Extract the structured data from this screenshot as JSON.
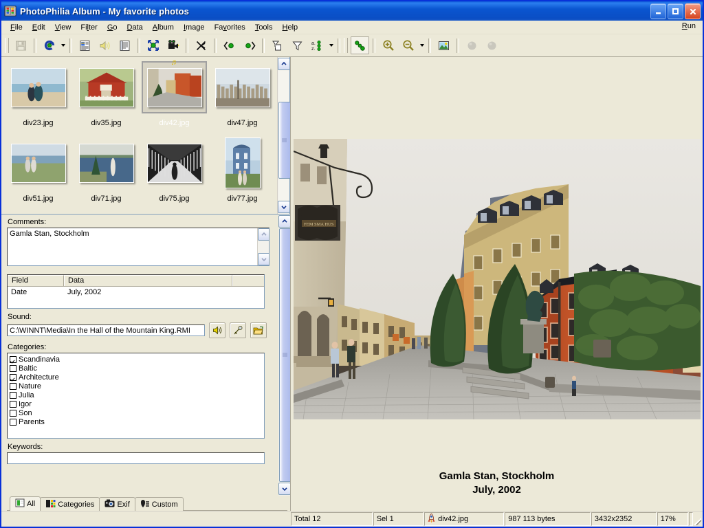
{
  "window": {
    "title": "PhotoPhilia Album - My favorite photos",
    "app_icon": "album-book-icon",
    "minimize_label": "Minimize",
    "maximize_label": "Maximize",
    "close_label": "Close"
  },
  "menu": {
    "items": [
      "File",
      "Edit",
      "View",
      "Filter",
      "Go",
      "Data",
      "Album",
      "Image",
      "Favorites",
      "Tools",
      "Help"
    ],
    "right_item": "Run"
  },
  "toolbar": {
    "buttons": [
      {
        "name": "save-button",
        "icon": "floppy-disk-icon",
        "state": "disabled"
      },
      {
        "name": "refresh-button",
        "icon": "blue-circular-arrow-icon",
        "state": "normal",
        "has_dropdown": true
      },
      {
        "name": "properties-button",
        "icon": "properties-sheet-icon",
        "state": "normal"
      },
      {
        "name": "sound-button",
        "icon": "speaker-icon",
        "state": "disabled"
      },
      {
        "name": "details-button",
        "icon": "list-details-icon",
        "state": "normal"
      },
      {
        "name": "fullscreen-button",
        "icon": "expand-arrows-icon",
        "state": "normal"
      },
      {
        "name": "slideshow-button",
        "icon": "movie-camera-icon",
        "state": "normal"
      },
      {
        "name": "random-button",
        "icon": "shuffle-icon",
        "state": "normal"
      },
      {
        "name": "previous-button",
        "icon": "left-arrow-icon",
        "state": "normal"
      },
      {
        "name": "next-button",
        "icon": "right-arrow-icon",
        "state": "normal"
      },
      {
        "name": "filter-page-button",
        "icon": "funnel-page-icon",
        "state": "normal"
      },
      {
        "name": "filter-button",
        "icon": "funnel-icon",
        "state": "normal"
      },
      {
        "name": "sort-button",
        "icon": "sort-az-icon",
        "state": "normal",
        "has_dropdown": true
      },
      {
        "name": "thumbnail-view-button",
        "icon": "chain-dots-icon",
        "state": "pressed"
      },
      {
        "name": "zoom-in-button",
        "icon": "magnifier-plus-icon",
        "state": "normal"
      },
      {
        "name": "zoom-out-button",
        "icon": "magnifier-minus-icon",
        "state": "normal",
        "has_dropdown": true
      },
      {
        "name": "image-editor-button",
        "icon": "picture-globe-icon",
        "state": "normal"
      },
      {
        "name": "record-a-button",
        "icon": "grey-circle-icon",
        "state": "disabled"
      },
      {
        "name": "record-b-button",
        "icon": "grey-circle-icon",
        "state": "disabled"
      }
    ]
  },
  "thumbnails": {
    "items": [
      {
        "file": "div23.jpg",
        "selected": false,
        "marked": false,
        "orientation": "landscape",
        "scene": "couple-on-beach"
      },
      {
        "file": "div35.jpg",
        "selected": false,
        "marked": false,
        "orientation": "landscape",
        "scene": "red-cottage"
      },
      {
        "file": "div42.jpg",
        "selected": true,
        "marked": true,
        "orientation": "landscape",
        "scene": "old-town-street"
      },
      {
        "file": "div47.jpg",
        "selected": false,
        "marked": false,
        "orientation": "landscape",
        "scene": "city-panorama"
      },
      {
        "file": "div51.jpg",
        "selected": false,
        "marked": false,
        "orientation": "landscape",
        "scene": "couple-at-shore"
      },
      {
        "file": "div71.jpg",
        "selected": false,
        "marked": false,
        "orientation": "landscape",
        "scene": "woman-by-lake"
      },
      {
        "file": "div75.jpg",
        "selected": false,
        "marked": false,
        "orientation": "landscape",
        "scene": "winter-alley"
      },
      {
        "file": "div77.jpg",
        "selected": false,
        "marked": false,
        "orientation": "portrait",
        "scene": "blue-tower-house"
      }
    ]
  },
  "details": {
    "comments_label": "Comments:",
    "comments_value": "Gamla Stan, Stockholm",
    "grid": {
      "headers": [
        "Field",
        "Data",
        ""
      ],
      "rows": [
        [
          "Date",
          "July, 2002",
          ""
        ]
      ]
    },
    "sound_label": "Sound:",
    "sound_value": "C:\\WINNT\\Media\\In the Hall of the Mountain King.RMI",
    "sound_buttons": [
      {
        "name": "play-sound-button",
        "icon": "speaker-icon"
      },
      {
        "name": "record-sound-button",
        "icon": "microphone-icon"
      },
      {
        "name": "browse-sound-button",
        "icon": "open-folder-icon"
      }
    ],
    "categories_label": "Categories:",
    "categories": [
      {
        "label": "Scandinavia",
        "checked": true
      },
      {
        "label": "Baltic",
        "checked": false
      },
      {
        "label": "Architecture",
        "checked": true
      },
      {
        "label": "Nature",
        "checked": false
      },
      {
        "label": "Julia",
        "checked": false
      },
      {
        "label": "Igor",
        "checked": false
      },
      {
        "label": "Son",
        "checked": false
      },
      {
        "label": "Parents",
        "checked": false
      }
    ],
    "keywords_label": "Keywords:",
    "keywords_value": ""
  },
  "tabs": [
    {
      "label": "All",
      "icon": "all-pages-icon",
      "active": true
    },
    {
      "label": "Categories",
      "icon": "categories-icon",
      "active": false
    },
    {
      "label": "Exif",
      "icon": "camera-icon",
      "active": false
    },
    {
      "label": "Custom",
      "icon": "custom-pen-icon",
      "active": false
    }
  ],
  "preview": {
    "caption_line1": "Gamla Stan, Stockholm",
    "caption_line2": "July, 2002",
    "image_alt": "old-town-street-photo"
  },
  "statusbar": {
    "total": "Total 12",
    "selection": "Sel 1",
    "filename": "div42.jpg",
    "filename_icon": "rocket-icon",
    "filesize": "987 113 bytes",
    "dimensions": "3432x2352",
    "zoom": "17%"
  },
  "colors": {
    "title_blue": "#0a55d0",
    "face": "#ece9d8",
    "border_blue": "#0831d9",
    "close_red": "#d4431f",
    "field_border": "#7f9db9"
  }
}
